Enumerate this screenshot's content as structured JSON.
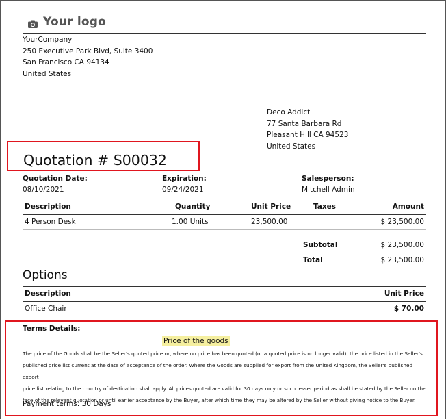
{
  "logo": {
    "text": "Your logo"
  },
  "company": {
    "name": "YourCompany",
    "street": "250 Executive Park Blvd, Suite 3400",
    "city": "San Francisco CA 94134",
    "country": "United States"
  },
  "customer": {
    "name": "Deco Addict",
    "street": "77 Santa Barbara Rd",
    "city": "Pleasant Hill CA 94523",
    "country": "United States"
  },
  "quotation": {
    "title": "Quotation # S00032",
    "date_label": "Quotation Date:",
    "date": "08/10/2021",
    "expiration_label": "Expiration:",
    "expiration": "09/24/2021",
    "salesperson_label": "Salesperson:",
    "salesperson": "Mitchell Admin"
  },
  "lines": {
    "headers": {
      "description": "Description",
      "quantity": "Quantity",
      "unit_price": "Unit Price",
      "taxes": "Taxes",
      "amount": "Amount"
    },
    "rows": [
      {
        "description": "4 Person Desk",
        "quantity": "1.00 Units",
        "unit_price": "23,500.00",
        "taxes": "",
        "amount": "$ 23,500.00"
      }
    ]
  },
  "totals": {
    "subtotal_label": "Subtotal",
    "subtotal": "$ 23,500.00",
    "total_label": "Total",
    "total": "$ 23,500.00"
  },
  "options": {
    "title": "Options",
    "headers": {
      "description": "Description",
      "unit_price": "Unit Price"
    },
    "rows": [
      {
        "description": "Office Chair",
        "unit_price": "$ 70.00"
      }
    ]
  },
  "terms": {
    "heading": "Terms Details:",
    "subheading": "Price of the goods",
    "lines": [
      "The price of the Goods shall be the Seller's quoted price or, where no price has been quoted (or a quoted price is no longer valid), the price listed in the Seller's",
      "published price list current at the date of acceptance of the order. Where the Goods are supplied for export from the United Kingdom, the Seller's published export",
      "price list relating to the country of destination shall apply. All prices quoted are valid for 30 days only or such lesser period as shall be stated by the Seller on the",
      "face of the relevant quotation or until earlier acceptance by the Buyer, after which time they may be altered by the Seller without giving notice to the Buyer."
    ],
    "payment": "Payment terms: 30 Days"
  },
  "colors": {
    "highlight_box": "#e0161f",
    "highlight_text_bg": "#f5ef9f"
  }
}
